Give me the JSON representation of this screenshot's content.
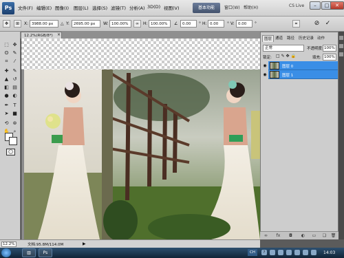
{
  "app": {
    "logo": "Ps"
  },
  "menu": [
    "文件(F)",
    "编辑(E)",
    "图像(I)",
    "图层(L)",
    "选择(S)",
    "滤镜(T)",
    "分析(A)",
    "3D(D)",
    "视图(V)",
    "窗口(W)",
    "帮助(H)"
  ],
  "menubar": {
    "zoom": "12.2",
    "workspace": "基本功能",
    "cs_live": "CS Live"
  },
  "options": {
    "x_label": "X:",
    "x_value": "3988.00 px",
    "y_label": "Y:",
    "y_value": "2695.00 px",
    "w_label": "W:",
    "w_value": "100.00%",
    "h_label": "H:",
    "h_value": "100.00%",
    "angle_value": "0.00",
    "h_skew_label": "H:",
    "h_skew_value": "0.00",
    "v_skew_label": "V:",
    "v_skew_value": "0.00",
    "cancel": "⊘",
    "commit": "✓"
  },
  "document": {
    "tab": "12.2%(RGB/8*)",
    "zoom": "12.2%",
    "info": "文档:95.8M/114.0M"
  },
  "layers_panel": {
    "tabs": [
      "图层",
      "通道",
      "路径",
      "历史记录",
      "动作"
    ],
    "blend_mode": "正常",
    "opacity_label": "不透明度:",
    "opacity": "100%",
    "lock_label": "锁定:",
    "fill_label": "填充:",
    "fill": "100%",
    "layers": [
      {
        "name": "图层 0"
      },
      {
        "name": "图层 1"
      }
    ]
  },
  "taskbar": {
    "lang": "CH",
    "clock": "14:03"
  },
  "colors": {
    "selection": "#3a8ee6",
    "menubar": "#dcdcdc",
    "taskbar": "#1a3550"
  }
}
